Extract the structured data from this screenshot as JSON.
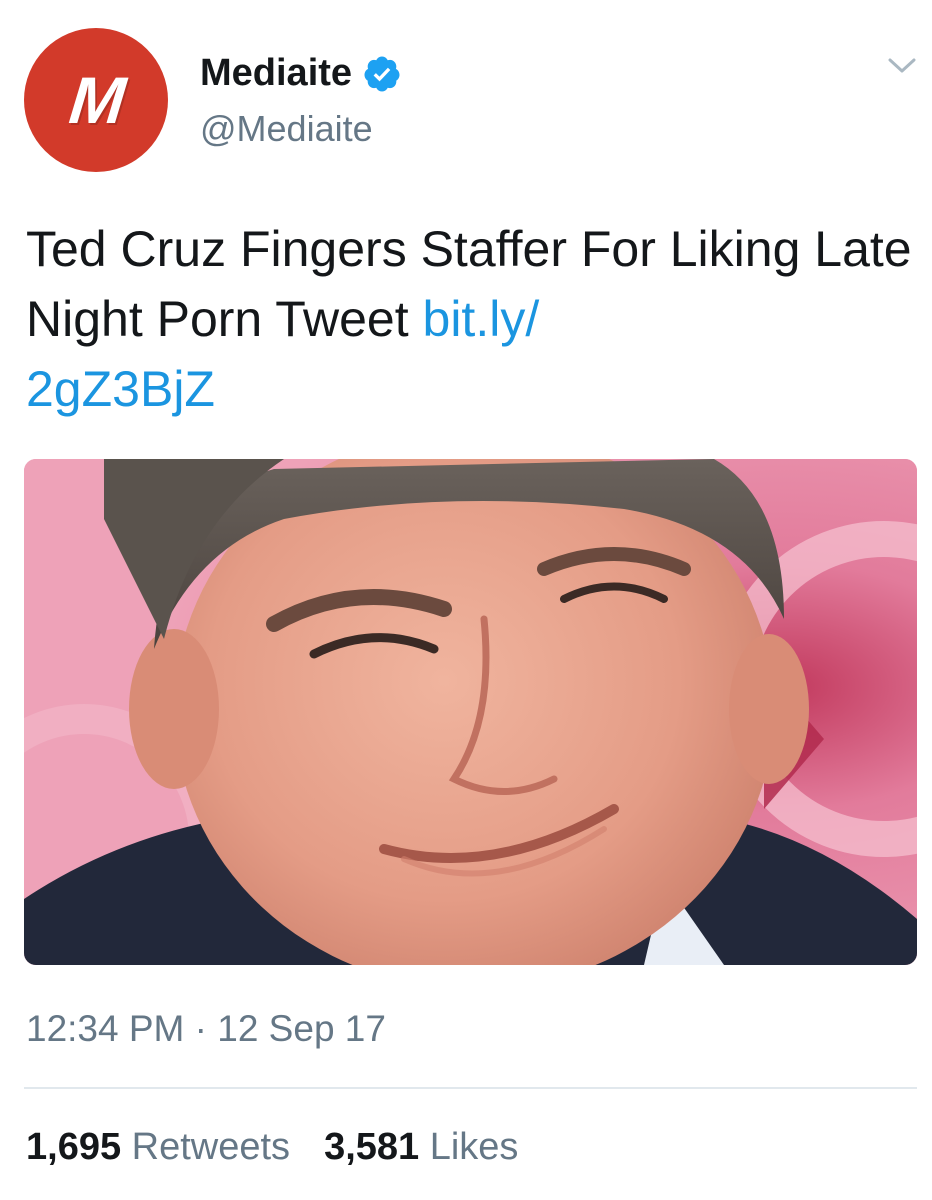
{
  "tweet": {
    "avatar": {
      "letter": "M",
      "color": "#d23a2a"
    },
    "author": {
      "display_name": "Mediaite",
      "handle": "@Mediaite",
      "verified": true,
      "verified_color": "#1da1f2"
    },
    "text": {
      "body": "Ted Cruz Fingers Staffer For Liking Late Night Porn Tweet ",
      "link": "bit.ly/\n2gZ3BjZ",
      "link_color": "#1b95e0"
    },
    "media": {
      "icon": "photo-of-smiling-man"
    },
    "timestamp": "12:34 PM · 12 Sep 17",
    "stats": {
      "retweets_count": "1,695",
      "retweets_label": "Retweets",
      "likes_count": "3,581",
      "likes_label": "Likes"
    }
  }
}
